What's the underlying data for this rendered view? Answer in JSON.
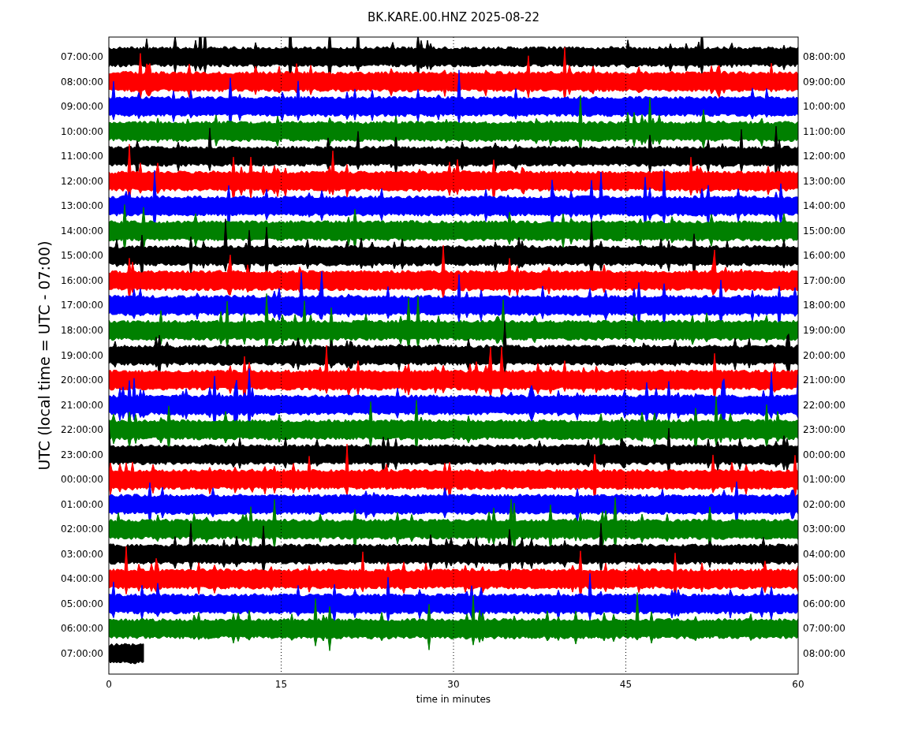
{
  "title": "BK.KARE.00.HNZ 2025-08-22",
  "y_axis_label": "UTC (local time = UTC - 07:00)",
  "x_axis_label": "time in minutes",
  "x_ticks": [
    "0",
    "15",
    "30",
    "45",
    "60"
  ],
  "rows": [
    {
      "utc": "07:00:00",
      "local": "08:00:00",
      "color": "#000000",
      "level": 1
    },
    {
      "utc": "08:00:00",
      "local": "09:00:00",
      "color": "#ff0000",
      "level": 1
    },
    {
      "utc": "09:00:00",
      "local": "10:00:00",
      "color": "#0000ff",
      "level": 1
    },
    {
      "utc": "10:00:00",
      "local": "11:00:00",
      "color": "#008000",
      "level": 1
    },
    {
      "utc": "11:00:00",
      "local": "12:00:00",
      "color": "#000000",
      "level": 1
    },
    {
      "utc": "12:00:00",
      "local": "13:00:00",
      "color": "#ff0000",
      "level": 1
    },
    {
      "utc": "13:00:00",
      "local": "14:00:00",
      "color": "#0000ff",
      "level": 1
    },
    {
      "utc": "14:00:00",
      "local": "15:00:00",
      "color": "#008000",
      "level": 1
    },
    {
      "utc": "15:00:00",
      "local": "16:00:00",
      "color": "#000000",
      "level": 1
    },
    {
      "utc": "16:00:00",
      "local": "17:00:00",
      "color": "#ff0000",
      "level": 1
    },
    {
      "utc": "17:00:00",
      "local": "18:00:00",
      "color": "#0000ff",
      "level": 1
    },
    {
      "utc": "18:00:00",
      "local": "19:00:00",
      "color": "#008000",
      "level": 1
    },
    {
      "utc": "19:00:00",
      "local": "20:00:00",
      "color": "#000000",
      "level": 1
    },
    {
      "utc": "20:00:00",
      "local": "21:00:00",
      "color": "#ff0000",
      "level": 1
    },
    {
      "utc": "21:00:00",
      "local": "22:00:00",
      "color": "#0000ff",
      "level": 1
    },
    {
      "utc": "22:00:00",
      "local": "23:00:00",
      "color": "#008000",
      "level": 1
    },
    {
      "utc": "23:00:00",
      "local": "00:00:00",
      "color": "#000000",
      "level": 1
    },
    {
      "utc": "00:00:00",
      "local": "01:00:00",
      "color": "#ff0000",
      "level": 1
    },
    {
      "utc": "01:00:00",
      "local": "02:00:00",
      "color": "#0000ff",
      "level": 1
    },
    {
      "utc": "02:00:00",
      "local": "03:00:00",
      "color": "#008000",
      "level": 1
    },
    {
      "utc": "03:00:00",
      "local": "04:00:00",
      "color": "#000000",
      "level": 1
    },
    {
      "utc": "04:00:00",
      "local": "05:00:00",
      "color": "#ff0000",
      "level": 1
    },
    {
      "utc": "05:00:00",
      "local": "06:00:00",
      "color": "#0000ff",
      "level": 1
    },
    {
      "utc": "06:00:00",
      "local": "07:00:00",
      "color": "#008000",
      "level": 1
    },
    {
      "utc": "07:00:00",
      "local": "08:00:00",
      "color": "#000000",
      "level": 0.052
    }
  ]
}
